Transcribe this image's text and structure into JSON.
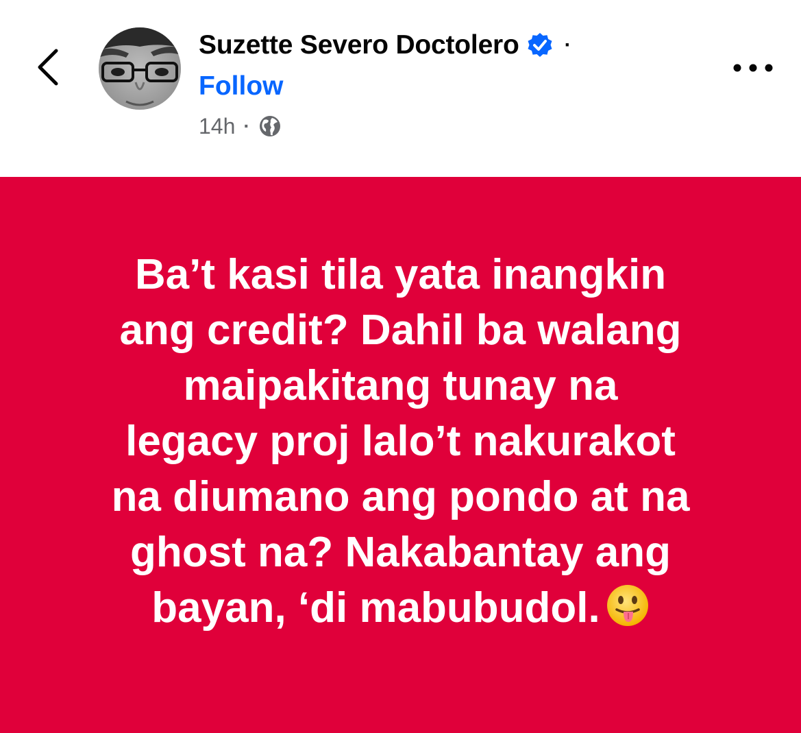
{
  "post": {
    "author_name": "Suzette Severo Doctolero",
    "verified": true,
    "name_separator": "·",
    "follow_label": "Follow",
    "timestamp": "14h",
    "meta_separator": "·",
    "audience_icon": "globe-icon",
    "more_icon": "more-horizontal-icon",
    "back_icon": "chevron-left-icon",
    "lines": [
      "Ba’t kasi tila yata inangkin",
      "ang credit?  Dahil ba walang",
      "maipakitang tunay na",
      "legacy proj lalo’t nakurakot",
      "na diumano ang pondo at na",
      "ghost na? Nakabantay ang",
      "bayan, ‘di mabubudol."
    ],
    "emoji": "face-with-tongue-icon"
  },
  "colors": {
    "background_card": "#e0003a",
    "link_blue": "#0866ff",
    "verified_blue": "#0866ff",
    "meta_gray": "#65676b",
    "text_dark": "#050505",
    "post_text": "#ffffff"
  }
}
